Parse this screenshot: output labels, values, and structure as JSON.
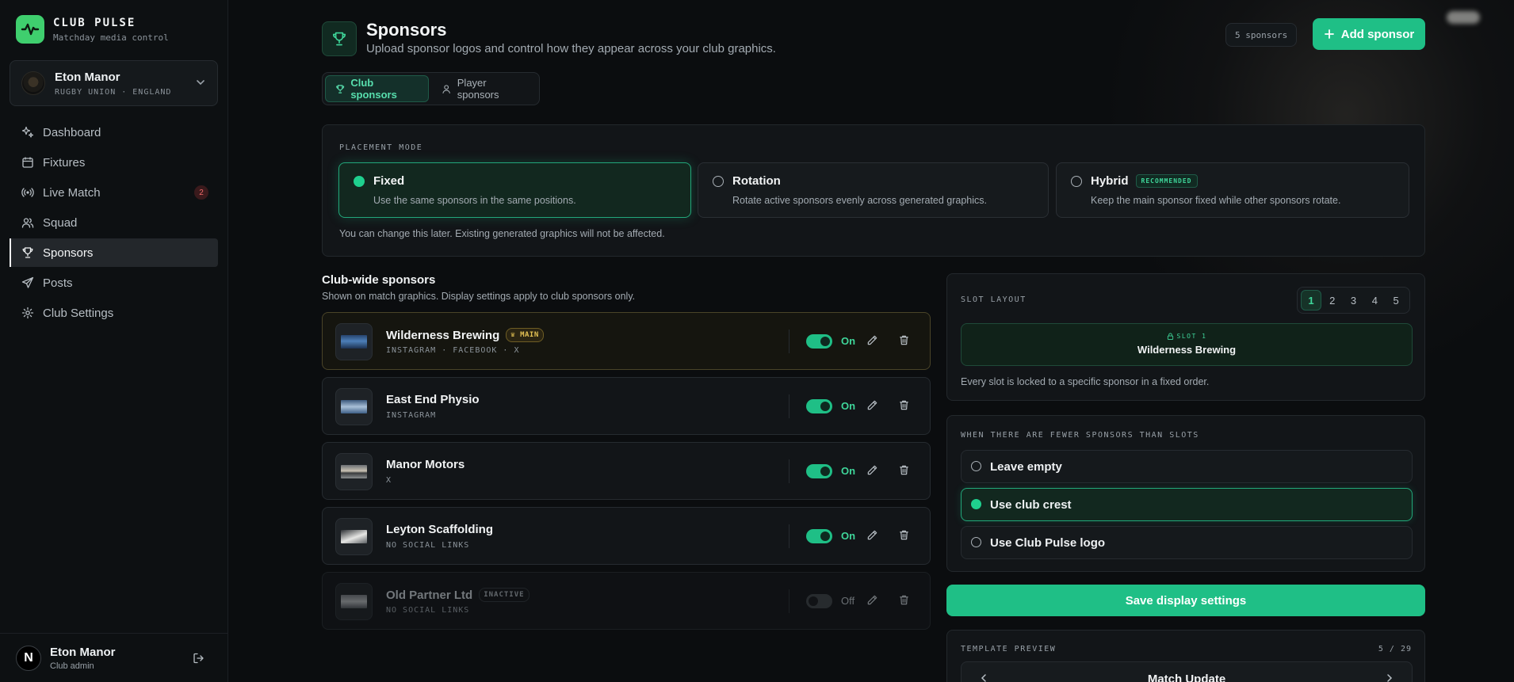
{
  "brand": {
    "name": "CLUB PULSE",
    "tagline": "Matchday media control",
    "accent": "#3fcf6e"
  },
  "club": {
    "name": "Eton Manor",
    "subtitle": "RUGBY UNION · ENGLAND"
  },
  "nav": [
    {
      "label": "Dashboard",
      "icon": "sparkle-icon"
    },
    {
      "label": "Fixtures",
      "icon": "calendar-icon"
    },
    {
      "label": "Live Match",
      "icon": "broadcast-icon",
      "badge": "2"
    },
    {
      "label": "Squad",
      "icon": "users-icon"
    },
    {
      "label": "Sponsors",
      "icon": "trophy-icon",
      "active": true
    },
    {
      "label": "Posts",
      "icon": "send-icon"
    },
    {
      "label": "Club Settings",
      "icon": "gear-icon"
    }
  ],
  "user": {
    "initial": "N",
    "name": "Eton Manor",
    "role": "Club admin"
  },
  "header": {
    "title": "Sponsors",
    "subtitle": "Upload sponsor logos and control how they appear across your club graphics.",
    "count": "5 sponsors",
    "add_label": "Add sponsor"
  },
  "tabs": [
    {
      "label": "Club sponsors",
      "active": true
    },
    {
      "label": "Player sponsors",
      "active": false
    }
  ],
  "placement": {
    "label": "PLACEMENT MODE",
    "modes": [
      {
        "title": "Fixed",
        "desc": "Use the same sponsors in the same positions.",
        "selected": true
      },
      {
        "title": "Rotation",
        "desc": "Rotate active sponsors evenly across generated graphics.",
        "selected": false
      },
      {
        "title": "Hybrid",
        "desc": "Keep the main sponsor fixed while other sponsors rotate.",
        "badge": "RECOMMENDED",
        "selected": false
      }
    ],
    "note": "You can change this later. Existing generated graphics will not be affected."
  },
  "sponsor_list": {
    "title": "Club-wide sponsors",
    "subtitle": "Shown on match graphics. Display settings apply to club sponsors only.",
    "items": [
      {
        "name": "Wilderness Brewing",
        "badge": "MAIN",
        "social": "INSTAGRAM · FACEBOOK · X",
        "state": "On",
        "enabled": true
      },
      {
        "name": "East End Physio",
        "social": "INSTAGRAM",
        "state": "On",
        "enabled": true
      },
      {
        "name": "Manor Motors",
        "social": "X",
        "state": "On",
        "enabled": true
      },
      {
        "name": "Leyton Scaffolding",
        "social": "NO SOCIAL LINKS",
        "state": "On",
        "enabled": true
      },
      {
        "name": "Old Partner Ltd",
        "badge": "INACTIVE",
        "social": "NO SOCIAL LINKS",
        "state": "Off",
        "enabled": false
      }
    ]
  },
  "slot_layout": {
    "label": "SLOT LAYOUT",
    "options": [
      "1",
      "2",
      "3",
      "4",
      "5"
    ],
    "selected": "1",
    "slot_tag": "SLOT 1",
    "slot_sponsor": "Wilderness Brewing",
    "note": "Every slot is locked to a specific sponsor in a fixed order."
  },
  "fewer": {
    "label": "WHEN THERE ARE FEWER SPONSORS THAN SLOTS",
    "options": [
      {
        "label": "Leave empty",
        "selected": false
      },
      {
        "label": "Use club crest",
        "selected": true
      },
      {
        "label": "Use Club Pulse logo",
        "selected": false
      }
    ]
  },
  "save_label": "Save display settings",
  "preview": {
    "label": "TEMPLATE PREVIEW",
    "count": "5 / 29",
    "name": "Match Update"
  }
}
